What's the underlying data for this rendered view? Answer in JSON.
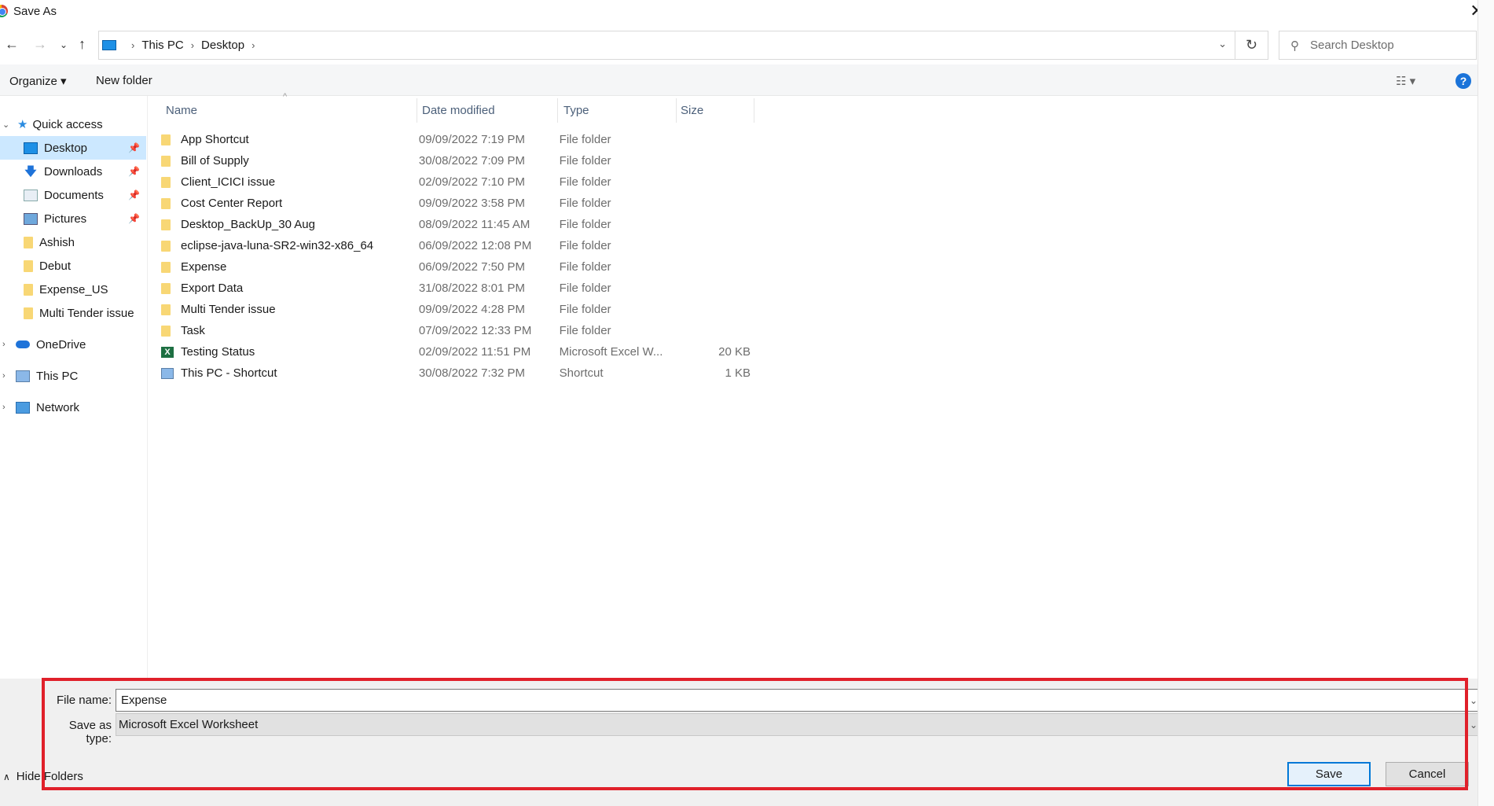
{
  "window": {
    "title": "Save As",
    "close": "✕"
  },
  "address": {
    "crumbs": [
      "This PC",
      "Desktop"
    ],
    "search_placeholder": "Search Desktop"
  },
  "toolbar": {
    "organize": "Organize ▾",
    "new_folder": "New folder",
    "help": "?"
  },
  "nav": {
    "quick_access": "Quick access",
    "pinned": [
      {
        "label": "Desktop",
        "selected": true
      },
      {
        "label": "Downloads"
      },
      {
        "label": "Documents"
      },
      {
        "label": "Pictures"
      }
    ],
    "folders": [
      "Ashish",
      "Debut",
      "Expense_US",
      "Multi Tender issue"
    ],
    "roots": [
      "OneDrive",
      "This PC",
      "Network"
    ]
  },
  "columns": {
    "name": "Name",
    "date": "Date modified",
    "type": "Type",
    "size": "Size"
  },
  "files": [
    {
      "name": "App Shortcut",
      "date": "09/09/2022 7:19 PM",
      "type": "File folder",
      "size": "",
      "icon": "folder"
    },
    {
      "name": "Bill of Supply",
      "date": "30/08/2022 7:09 PM",
      "type": "File folder",
      "size": "",
      "icon": "folder"
    },
    {
      "name": "Client_ICICI issue",
      "date": "02/09/2022 7:10 PM",
      "type": "File folder",
      "size": "",
      "icon": "folder"
    },
    {
      "name": "Cost Center Report",
      "date": "09/09/2022 3:58 PM",
      "type": "File folder",
      "size": "",
      "icon": "folder"
    },
    {
      "name": "Desktop_BackUp_30 Aug",
      "date": "08/09/2022 11:45 AM",
      "type": "File folder",
      "size": "",
      "icon": "folder"
    },
    {
      "name": "eclipse-java-luna-SR2-win32-x86_64",
      "date": "06/09/2022 12:08 PM",
      "type": "File folder",
      "size": "",
      "icon": "folder"
    },
    {
      "name": "Expense",
      "date": "06/09/2022 7:50 PM",
      "type": "File folder",
      "size": "",
      "icon": "folder"
    },
    {
      "name": "Export Data",
      "date": "31/08/2022 8:01 PM",
      "type": "File folder",
      "size": "",
      "icon": "folder"
    },
    {
      "name": "Multi Tender issue",
      "date": "09/09/2022 4:28 PM",
      "type": "File folder",
      "size": "",
      "icon": "folder"
    },
    {
      "name": "Task",
      "date": "07/09/2022 12:33 PM",
      "type": "File folder",
      "size": "",
      "icon": "folder"
    },
    {
      "name": "Testing Status",
      "date": "02/09/2022 11:51 PM",
      "type": "Microsoft Excel W...",
      "size": "20 KB",
      "icon": "excel"
    },
    {
      "name": "This PC - Shortcut",
      "date": "30/08/2022 7:32 PM",
      "type": "Shortcut",
      "size": "1 KB",
      "icon": "shortcut"
    }
  ],
  "form": {
    "file_name_label": "File name:",
    "file_name": "Expense",
    "type_label": "Save as type:",
    "type": "Microsoft Excel Worksheet"
  },
  "buttons": {
    "hide_folders": "Hide Folders",
    "save": "Save",
    "cancel": "Cancel"
  },
  "colors": {
    "highlight": "#e0202a",
    "selected": "#cce8ff",
    "accent": "#0078d7"
  }
}
